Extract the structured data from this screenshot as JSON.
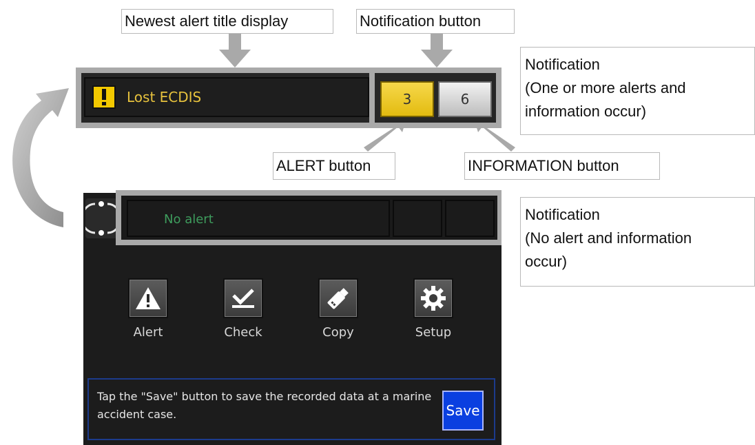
{
  "callouts": {
    "newest_alert_title": "Newest alert title display",
    "notification_button": "Notification button",
    "notification_with_alerts": {
      "line1": "Notification",
      "line2": "(One or more alerts and",
      "line3": "information occur)"
    },
    "alert_button": "ALERT button",
    "information_button": "INFORMATION button",
    "notification_no_alerts": {
      "line1": "Notification",
      "line2": "(No alert and information",
      "line3": "occur)"
    }
  },
  "top_bar": {
    "alert_title": "Lost ECDIS",
    "alert_count": "3",
    "info_count": "6"
  },
  "screen": {
    "status_text": "No alert",
    "menu": [
      {
        "label": "Alert",
        "icon": "warning-triangle-icon"
      },
      {
        "label": "Check",
        "icon": "checkmark-icon"
      },
      {
        "label": "Copy",
        "icon": "usb-memory-icon"
      },
      {
        "label": "Setup",
        "icon": "gear-icon"
      }
    ],
    "message": "Tap the \"Save\" button to save the recorded data at a marine accident case.",
    "save_label": "Save"
  },
  "colors": {
    "alert_yellow": "#f3c900",
    "status_green": "#3e9c5d",
    "save_blue": "#0a3fe0"
  }
}
